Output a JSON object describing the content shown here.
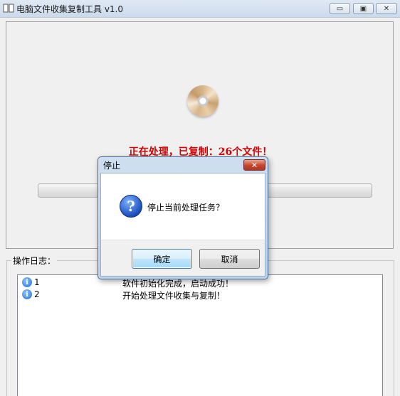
{
  "window": {
    "title": "电脑文件收集复制工具 v1.0",
    "controls": {
      "minimize": "▭",
      "maximize": "▣",
      "close": "✕"
    }
  },
  "progress_panel": {
    "status_text": "正在处理，已复制：26个文件！",
    "progress": 0,
    "disc_icon": "disc-icon"
  },
  "log": {
    "label": "操作日志：",
    "entries": [
      {
        "index": "1",
        "message": "软件初始化完成，启动成功！",
        "icon": "info-icon"
      },
      {
        "index": "2",
        "message": "开始处理文件收集与复制！",
        "icon": "info-icon"
      }
    ]
  },
  "dialog": {
    "title": "停止",
    "close_label": "✕",
    "message": "停止当前处理任务？",
    "icon": "question-icon",
    "ok_label": "确定",
    "cancel_label": "取消"
  },
  "colors": {
    "status_text": "#d80000",
    "dialog_frame": "#bdd2ea",
    "info_icon": "#1f6fd6"
  }
}
